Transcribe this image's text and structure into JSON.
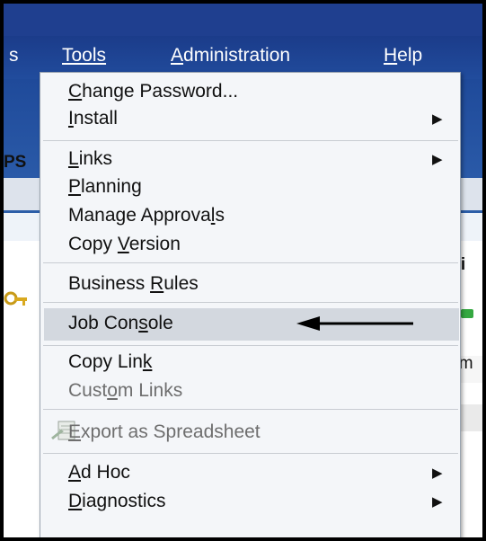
{
  "menubar": {
    "items": [
      {
        "label": "s"
      },
      {
        "label": "Tools"
      },
      {
        "label": "Administration"
      },
      {
        "label": "Help"
      }
    ]
  },
  "background": {
    "fragment_left": "PS",
    "fragment_right_1": "pli",
    "fragment_right_2": "lam"
  },
  "tools_menu": {
    "items": [
      {
        "label": "Change Password...",
        "has_submenu": false,
        "disabled": false
      },
      {
        "label": "Install",
        "has_submenu": true,
        "disabled": false
      },
      {
        "label": "Links",
        "has_submenu": true,
        "disabled": false
      },
      {
        "label": "Planning",
        "has_submenu": false,
        "disabled": false
      },
      {
        "label": "Manage Approvals",
        "has_submenu": false,
        "disabled": false
      },
      {
        "label": "Copy Version",
        "has_submenu": false,
        "disabled": false
      },
      {
        "label": "Business Rules",
        "has_submenu": false,
        "disabled": false
      },
      {
        "label": "Job Console",
        "has_submenu": false,
        "disabled": false,
        "highlighted": true
      },
      {
        "label": "Copy Link",
        "has_submenu": false,
        "disabled": false
      },
      {
        "label": "Custom Links",
        "has_submenu": false,
        "disabled": true
      },
      {
        "label": "Export as Spreadsheet",
        "has_submenu": false,
        "disabled": true,
        "icon": "export-spreadsheet-icon"
      },
      {
        "label": "Ad Hoc",
        "has_submenu": true,
        "disabled": false
      },
      {
        "label": "Diagnostics",
        "has_submenu": true,
        "disabled": false
      }
    ],
    "submenu_arrow_glyph": "▶"
  },
  "colors": {
    "menubar_blue": "#1f4a9a",
    "menu_bg": "#f4f6f9",
    "highlight_bg": "#d3d8df",
    "disabled_text": "#6e6e6e"
  }
}
